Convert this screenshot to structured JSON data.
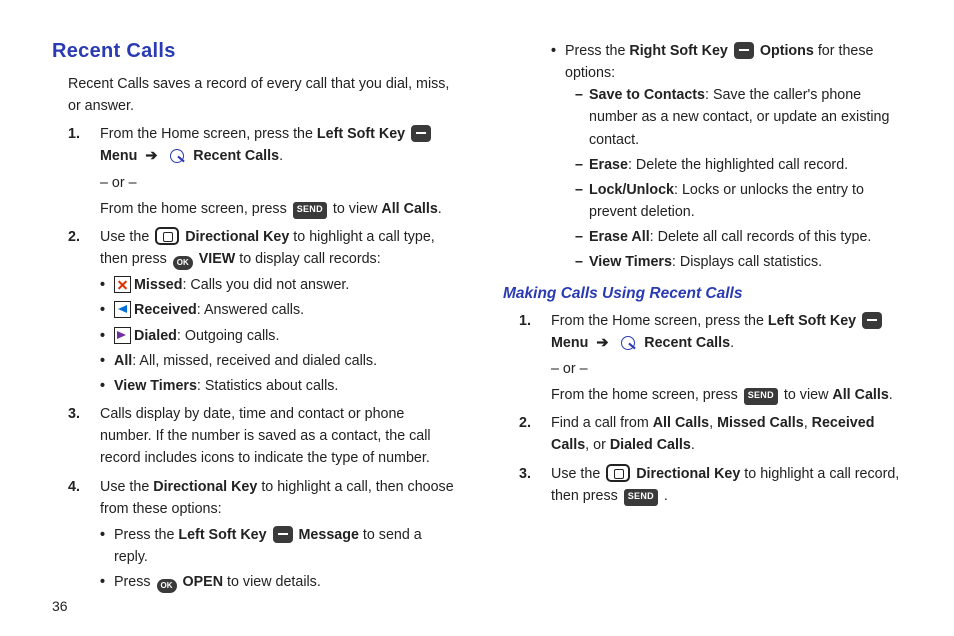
{
  "page_number": "36",
  "left": {
    "heading": "Recent Calls",
    "intro": "Recent Calls saves a record of every call that you dial, miss, or answer.",
    "s1": {
      "lead": "From the Home screen, press the ",
      "lsk": "Left Soft Key",
      "menu": "Menu",
      "rc": "Recent Calls",
      "or": "– or –",
      "alt_a": "From the home screen, press ",
      "alt_b": " to view ",
      "allcalls": "All Calls",
      "send": "SEND"
    },
    "s2": {
      "a": "Use the ",
      "dk": "Directional Key",
      "b": " to highlight a call type, then press ",
      "view": "VIEW",
      "c": " to display call records:",
      "ok": "OK",
      "missed_b": "Missed",
      "missed_t": ": Calls you did not answer.",
      "recv_b": "Received",
      "recv_t": ": Answered calls.",
      "dial_b": "Dialed",
      "dial_t": ": Outgoing calls.",
      "all_b": "All",
      "all_t": ": All, missed, received and dialed calls.",
      "vt_b": "View Timers",
      "vt_t": ": Statistics about calls."
    },
    "s3": "Calls display by date, time and contact or phone number. If the number is saved as a contact, the call record includes icons to indicate the type of number.",
    "s4": {
      "a": "Use the ",
      "dk": "Directional Key",
      "b": " to highlight a call, then choose from these options:",
      "b1a": "Press the ",
      "b1b": "Left Soft Key",
      "b1c": "Message",
      "b1d": " to send a reply.",
      "b2a": "Press ",
      "b2b": "OPEN",
      "b2c": " to view details.",
      "ok": "OK"
    }
  },
  "right": {
    "top": {
      "lead_a": "Press the ",
      "lead_b": "Right Soft Key",
      "lead_c": "Options",
      "lead_d": " for these options:",
      "d1b": "Save to Contacts",
      "d1t": ": Save the caller's phone number as a new contact, or update an existing contact.",
      "d2b": "Erase",
      "d2t": ": Delete the highlighted call record.",
      "d3b": "Lock/Unlock",
      "d3t": ": Locks or unlocks the entry to prevent deletion.",
      "d4b": "Erase All",
      "d4t": ": Delete all call records of this type.",
      "d5b": "View Timers",
      "d5t": ": Displays call statistics."
    },
    "heading2": "Making Calls Using Recent Calls",
    "r1": {
      "lead": "From the Home screen, press the ",
      "lsk": "Left Soft Key",
      "menu": "Menu",
      "rc": "Recent Calls",
      "or": "– or –",
      "alt_a": "From the home screen, press ",
      "alt_b": " to view ",
      "allcalls": "All Calls",
      "send": "SEND"
    },
    "r2": {
      "a": "Find a call from ",
      "ac": "All Calls",
      "mc": "Missed Calls",
      "rc": "Received Calls",
      "dc": "Dialed Calls",
      "or": ", or "
    },
    "r3": {
      "a": "Use the ",
      "dk": "Directional Key",
      "b": " to highlight a call record, then press ",
      "send": "SEND"
    }
  }
}
